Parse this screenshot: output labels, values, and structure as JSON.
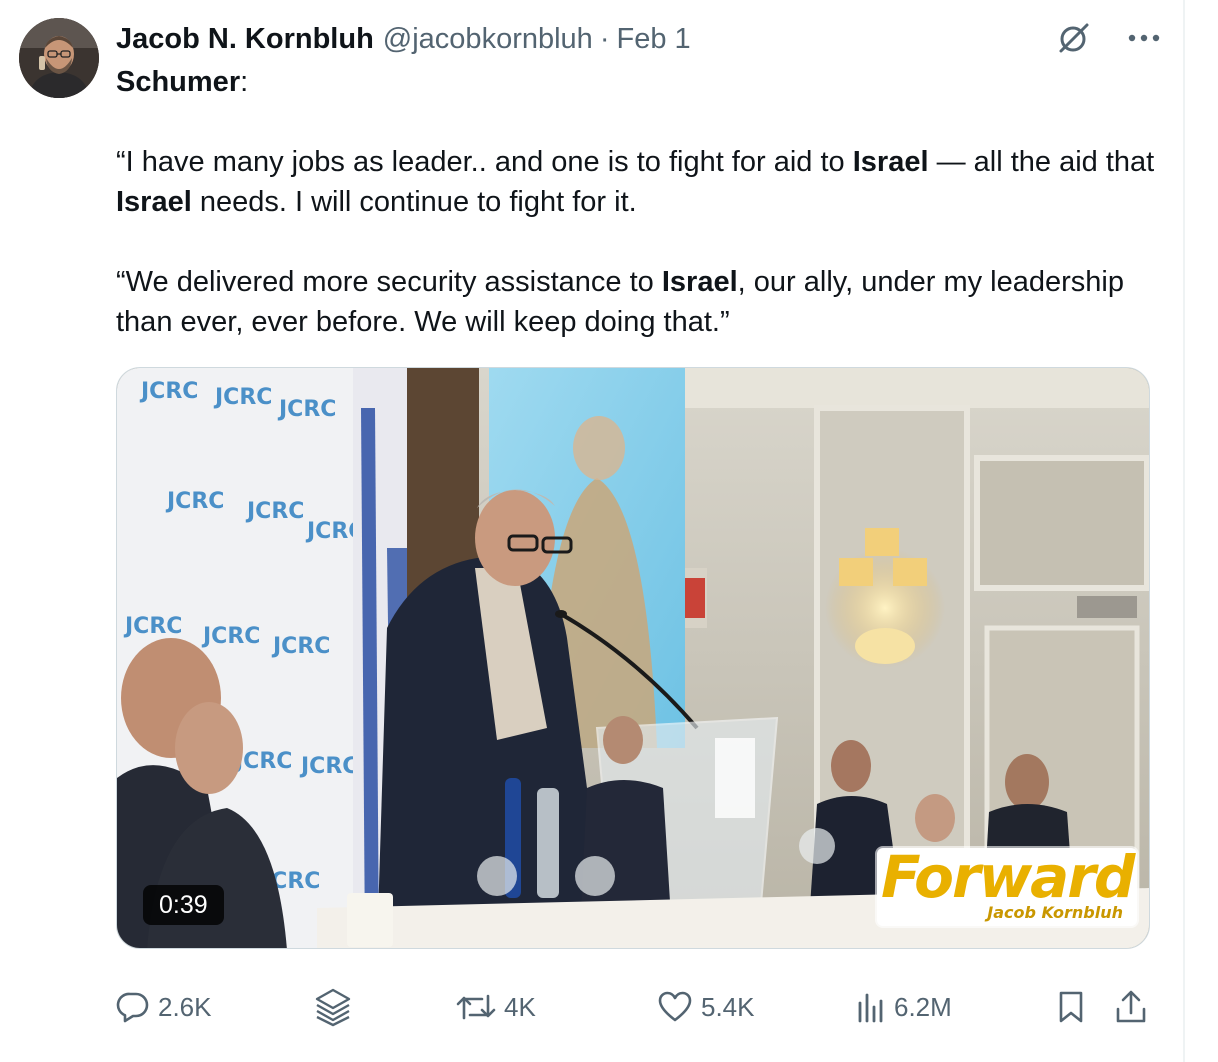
{
  "post": {
    "author": {
      "name": "Jacob N. Kornbluh",
      "handle": "@jacobkornbluh",
      "separator": "·",
      "date": "Feb 1"
    },
    "text": {
      "lead": "Schumer",
      "lead_colon": ":",
      "p1_a": "“I have many jobs as leader.. and one is to fight for aid to ",
      "p1_b": "Israel",
      "p1_c": " — all the aid that ",
      "p1_d": "Israel",
      "p1_e": " needs. I will continue to fight for it.",
      "p2_a": "“We delivered more security assistance to ",
      "p2_b": "Israel",
      "p2_c": ", our ally, under my leadership than ever, ever before. We will keep doing that.”"
    },
    "media": {
      "type": "video",
      "duration": "0:39",
      "watermark_brand": "Forward",
      "watermark_byline": "Jacob Kornbluh",
      "backdrop_logo_text": "JCRC"
    },
    "actions": {
      "replies": "2.6K",
      "reposts": "4K",
      "likes": "5.4K",
      "views": "6.2M"
    }
  },
  "icons": {
    "grok": "grok-icon",
    "more": "more-icon",
    "reply": "reply-icon",
    "stack": "layers-icon",
    "repost": "repost-icon",
    "like": "heart-icon",
    "views": "views-icon",
    "bookmark": "bookmark-icon",
    "share": "share-icon"
  },
  "colors": {
    "text": "#0f1419",
    "muted": "#536471",
    "border": "#cfd9de",
    "watermark": "#e9b000"
  }
}
